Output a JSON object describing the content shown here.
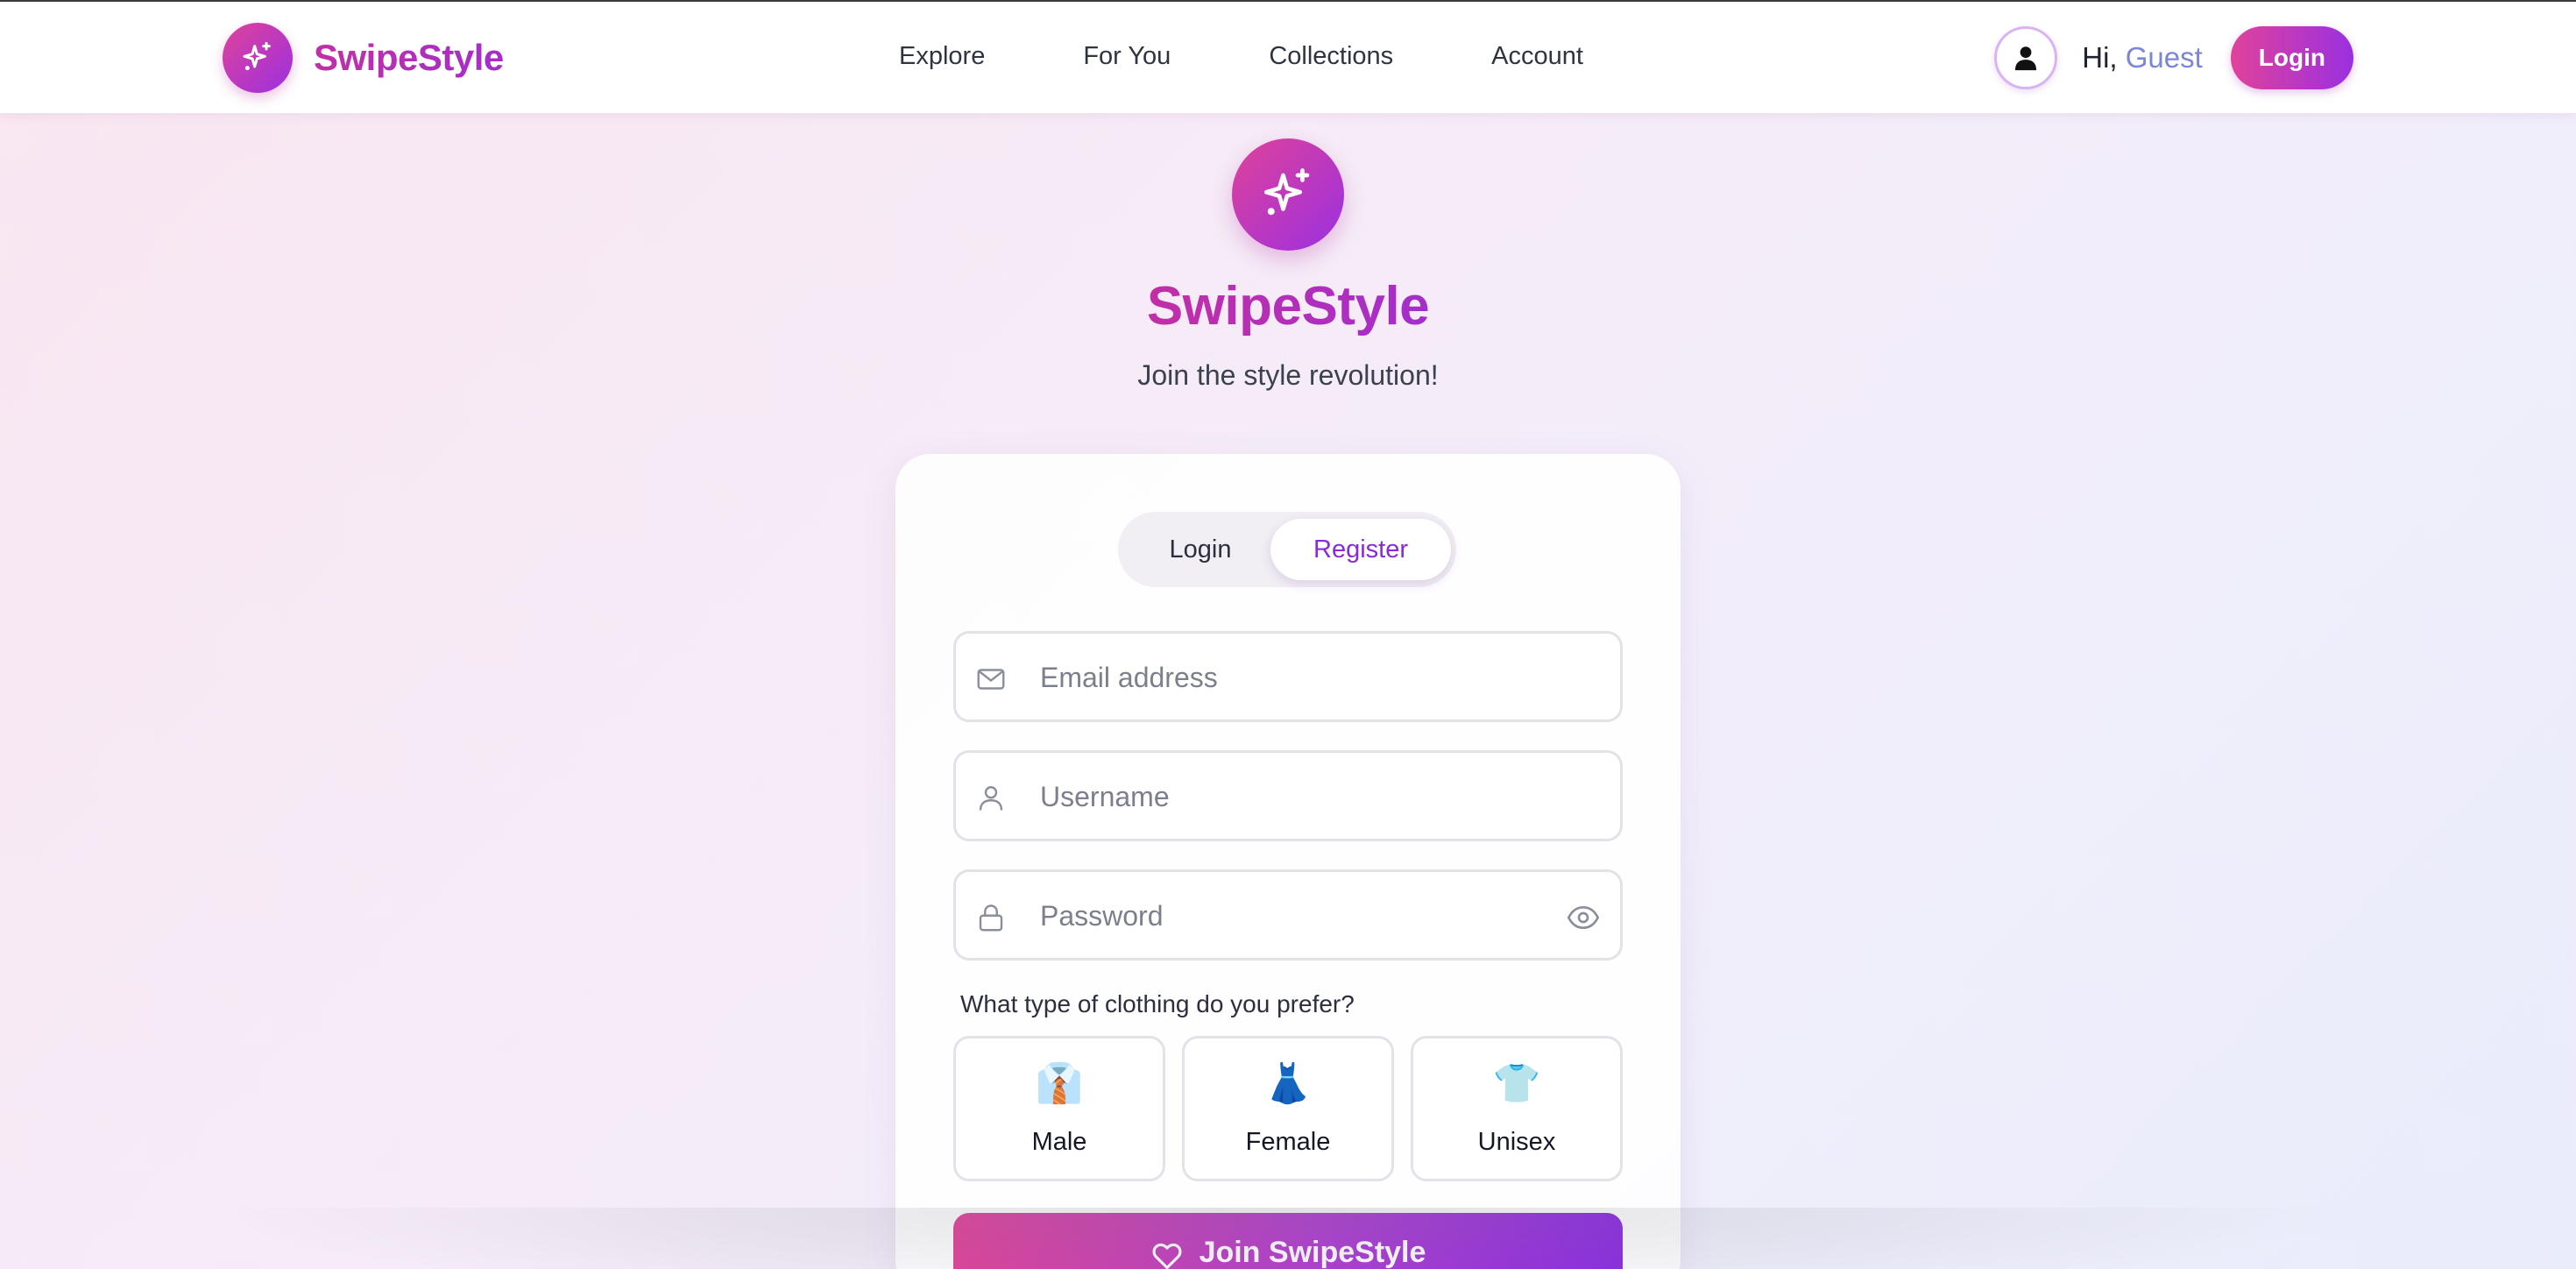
{
  "brand": {
    "name": "SwipeStyle",
    "logo_icon": "sparkles-icon",
    "accent_gradient": [
      "#e0429a",
      "#9b30e0"
    ]
  },
  "nav": {
    "links": [
      {
        "label": "Explore"
      },
      {
        "label": "For You"
      },
      {
        "label": "Collections"
      },
      {
        "label": "Account"
      }
    ],
    "greeting_prefix": "Hi, ",
    "user_name": "Guest",
    "login_button": "Login",
    "avatar_icon": "user-icon"
  },
  "hero": {
    "title": "SwipeStyle",
    "subtitle": "Join the style revolution!"
  },
  "auth": {
    "tabs": {
      "login": "Login",
      "register": "Register",
      "active": "register"
    },
    "fields": {
      "email": {
        "placeholder": "Email address",
        "value": "",
        "icon": "mail-icon"
      },
      "username": {
        "placeholder": "Username",
        "value": "",
        "icon": "user-icon"
      },
      "password": {
        "placeholder": "Password",
        "value": "",
        "icon": "lock-icon",
        "toggle_icon": "eye-icon"
      }
    },
    "preference": {
      "question": "What type of clothing do you prefer?",
      "options": [
        {
          "emoji": "👔",
          "label": "Male"
        },
        {
          "emoji": "👗",
          "label": "Female"
        },
        {
          "emoji": "👕",
          "label": "Unisex"
        }
      ]
    },
    "submit_label": "Join SwipeStyle",
    "submit_icon": "heart-icon"
  }
}
